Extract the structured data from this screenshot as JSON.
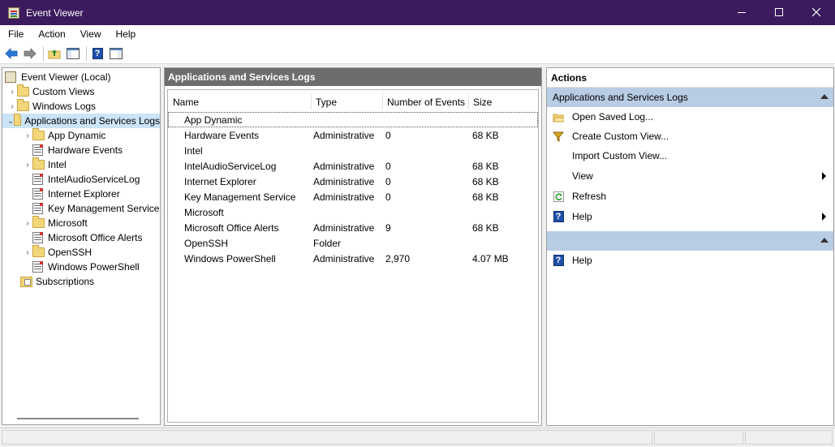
{
  "window": {
    "title": "Event Viewer"
  },
  "menu": [
    "File",
    "Action",
    "View",
    "Help"
  ],
  "tree": {
    "root": "Event Viewer (Local)",
    "items": [
      {
        "label": "Custom Views",
        "level": 1,
        "expander": "collapsed",
        "icon": "folder-icon"
      },
      {
        "label": "Windows Logs",
        "level": 1,
        "expander": "collapsed",
        "icon": "folder-icon"
      },
      {
        "label": "Applications and Services Logs",
        "level": 1,
        "expander": "expanded",
        "icon": "folder-icon",
        "selected": true
      },
      {
        "label": "App Dynamic",
        "level": 2,
        "expander": "collapsed",
        "icon": "folder-icon"
      },
      {
        "label": "Hardware Events",
        "level": 2,
        "expander": "none",
        "icon": "log-icon"
      },
      {
        "label": "Intel",
        "level": 2,
        "expander": "collapsed",
        "icon": "folder-icon"
      },
      {
        "label": "IntelAudioServiceLog",
        "level": 2,
        "expander": "none",
        "icon": "log-icon"
      },
      {
        "label": "Internet Explorer",
        "level": 2,
        "expander": "none",
        "icon": "log-icon"
      },
      {
        "label": "Key Management Service",
        "level": 2,
        "expander": "none",
        "icon": "log-icon"
      },
      {
        "label": "Microsoft",
        "level": 2,
        "expander": "collapsed",
        "icon": "folder-icon"
      },
      {
        "label": "Microsoft Office Alerts",
        "level": 2,
        "expander": "none",
        "icon": "log-icon"
      },
      {
        "label": "OpenSSH",
        "level": 2,
        "expander": "collapsed",
        "icon": "folder-icon"
      },
      {
        "label": "Windows PowerShell",
        "level": 2,
        "expander": "none",
        "icon": "log-icon"
      },
      {
        "label": "Subscriptions",
        "level": 1,
        "expander": "none",
        "icon": "subscriptions-icon"
      }
    ]
  },
  "center": {
    "header": "Applications and Services Logs",
    "columns": [
      "Name",
      "Type",
      "Number of Events",
      "Size"
    ],
    "rows": [
      {
        "name": "App Dynamic",
        "type": "",
        "events": "",
        "size": "",
        "focused": true
      },
      {
        "name": "Hardware Events",
        "type": "Administrative",
        "events": "0",
        "size": "68 KB"
      },
      {
        "name": "Intel",
        "type": "",
        "events": "",
        "size": ""
      },
      {
        "name": "IntelAudioServiceLog",
        "type": "Administrative",
        "events": "0",
        "size": "68 KB"
      },
      {
        "name": "Internet Explorer",
        "type": "Administrative",
        "events": "0",
        "size": "68 KB"
      },
      {
        "name": "Key Management Service",
        "type": "Administrative",
        "events": "0",
        "size": "68 KB"
      },
      {
        "name": "Microsoft",
        "type": "",
        "events": "",
        "size": ""
      },
      {
        "name": "Microsoft Office Alerts",
        "type": "Administrative",
        "events": "9",
        "size": "68 KB"
      },
      {
        "name": "OpenSSH",
        "type": "Folder",
        "events": "",
        "size": ""
      },
      {
        "name": "Windows PowerShell",
        "type": "Administrative",
        "events": "2,970",
        "size": "4.07 MB"
      }
    ]
  },
  "actions": {
    "title": "Actions",
    "section1": {
      "title": "Applications and Services Logs",
      "items": [
        {
          "label": "Open Saved Log...",
          "icon": "open-folder-icon",
          "submenu": false
        },
        {
          "label": "Create Custom View...",
          "icon": "filter-icon",
          "submenu": false
        },
        {
          "label": "Import Custom View...",
          "icon": "",
          "submenu": false
        },
        {
          "label": "View",
          "icon": "",
          "submenu": true
        },
        {
          "label": "Refresh",
          "icon": "refresh-icon",
          "submenu": false
        },
        {
          "label": "Help",
          "icon": "help-icon",
          "submenu": true
        }
      ]
    },
    "section2": {
      "title": "",
      "items": [
        {
          "label": "Help",
          "icon": "help-icon",
          "submenu": false
        }
      ]
    }
  },
  "colors": {
    "titlebar": "#3b1a5e",
    "selection": "#cce4f7",
    "pane_header": "#6d6d6d",
    "actions_section": "#b8cce4"
  }
}
